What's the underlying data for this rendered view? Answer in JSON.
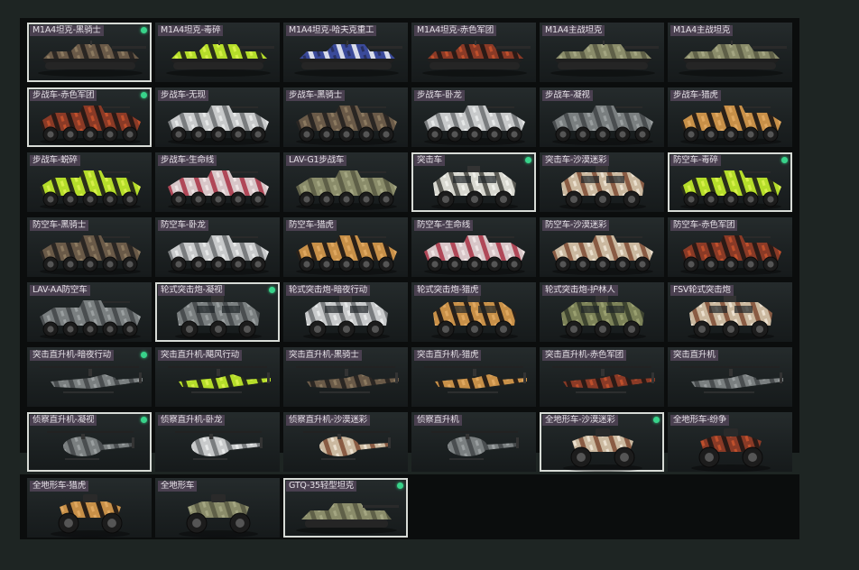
{
  "colors": {
    "bg": "#1e2523",
    "panel": "#0b0d0d",
    "label_bg": "#4a4050",
    "equipped_dot": "#38d38a",
    "selected_border": "#d7dbd6"
  },
  "main": {
    "tiles": [
      {
        "label": "M1A4坦克-黑骑士",
        "kind": "tank",
        "pattern": "blackknight",
        "selected": true,
        "equipped": true
      },
      {
        "label": "M1A4坦克-毒碎",
        "kind": "tank",
        "pattern": "toxic",
        "selected": false,
        "equipped": false
      },
      {
        "label": "M1A4坦克-哈夫克重工",
        "kind": "tank",
        "pattern": "haavk",
        "selected": false,
        "equipped": false
      },
      {
        "label": "M1A4坦克-赤色军团",
        "kind": "tank",
        "pattern": "redlegion",
        "selected": false,
        "equipped": false
      },
      {
        "label": "M1A4主战坦克",
        "kind": "tank",
        "pattern": "olive",
        "selected": false,
        "equipped": false
      },
      {
        "label": "M1A4主战坦克",
        "kind": "tank",
        "pattern": "olive",
        "selected": false,
        "equipped": false
      },
      {
        "label": "步战车-赤色军团",
        "kind": "ifv",
        "pattern": "redlegion",
        "selected": true,
        "equipped": true
      },
      {
        "label": "步战车-无现",
        "kind": "ifv",
        "pattern": "white",
        "selected": false,
        "equipped": false
      },
      {
        "label": "步战车-黑骑士",
        "kind": "ifv",
        "pattern": "blackknight",
        "selected": false,
        "equipped": false
      },
      {
        "label": "步战车-卧龙",
        "kind": "ifv",
        "pattern": "white",
        "selected": false,
        "equipped": false
      },
      {
        "label": "步战车-凝视",
        "kind": "ifv",
        "pattern": "grey",
        "selected": false,
        "equipped": false
      },
      {
        "label": "步战车-猎虎",
        "kind": "ifv",
        "pattern": "tiger",
        "selected": false,
        "equipped": false
      },
      {
        "label": "步战车-蜕碎",
        "kind": "ifv",
        "pattern": "toxic",
        "selected": false,
        "equipped": false
      },
      {
        "label": "步战车-生命线",
        "kind": "ifv",
        "pattern": "pinkwhite",
        "selected": false,
        "equipped": false
      },
      {
        "label": "LAV-G1步战车",
        "kind": "ifv",
        "pattern": "olive",
        "selected": false,
        "equipped": false
      },
      {
        "label": "突击车",
        "kind": "mrap",
        "pattern": "snowcamo",
        "selected": true,
        "equipped": true
      },
      {
        "label": "突击车-沙漠迷彩",
        "kind": "mrap",
        "pattern": "desertcamo",
        "selected": false,
        "equipped": false
      },
      {
        "label": "防空车-毒碎",
        "kind": "ifv",
        "pattern": "toxic",
        "selected": true,
        "equipped": true
      },
      {
        "label": "防空车-黑骑士",
        "kind": "ifv",
        "pattern": "blackknight",
        "selected": false,
        "equipped": false
      },
      {
        "label": "防空车-卧龙",
        "kind": "ifv",
        "pattern": "white",
        "selected": false,
        "equipped": false
      },
      {
        "label": "防空车-猎虎",
        "kind": "ifv",
        "pattern": "tiger",
        "selected": false,
        "equipped": false
      },
      {
        "label": "防空车-生命线",
        "kind": "ifv",
        "pattern": "pinkwhite",
        "selected": false,
        "equipped": false
      },
      {
        "label": "防空车-沙漠迷彩",
        "kind": "ifv",
        "pattern": "desertcamo",
        "selected": false,
        "equipped": false
      },
      {
        "label": "防空车-赤色军团",
        "kind": "ifv",
        "pattern": "redlegion",
        "selected": false,
        "equipped": false
      },
      {
        "label": "LAV-AA防空车",
        "kind": "ifv",
        "pattern": "grey",
        "selected": false,
        "equipped": false
      },
      {
        "label": "轮式突击炮-凝视",
        "kind": "armored",
        "pattern": "grey",
        "selected": true,
        "equipped": true
      },
      {
        "label": "轮式突击炮-暗夜行动",
        "kind": "armored",
        "pattern": "white",
        "selected": false,
        "equipped": false
      },
      {
        "label": "轮式突击炮-猎虎",
        "kind": "armored",
        "pattern": "tiger",
        "selected": false,
        "equipped": false
      },
      {
        "label": "轮式突击炮-护林人",
        "kind": "armored",
        "pattern": "forest",
        "selected": false,
        "equipped": false
      },
      {
        "label": "FSV轮式突击炮",
        "kind": "armored",
        "pattern": "desertcamo",
        "selected": false,
        "equipped": false
      },
      {
        "label": "突击直升机-暗夜行动",
        "kind": "heli",
        "pattern": "grey",
        "selected": false,
        "equipped": true
      },
      {
        "label": "突击直升机-飓风行动",
        "kind": "heli",
        "pattern": "toxic",
        "selected": false,
        "equipped": false
      },
      {
        "label": "突击直升机-黑骑士",
        "kind": "heli",
        "pattern": "blackknight",
        "selected": false,
        "equipped": false
      },
      {
        "label": "突击直升机-猎虎",
        "kind": "heli",
        "pattern": "tiger",
        "selected": false,
        "equipped": false
      },
      {
        "label": "突击直升机-赤色军团",
        "kind": "heli",
        "pattern": "redlegion",
        "selected": false,
        "equipped": false
      },
      {
        "label": "突击直升机",
        "kind": "heli",
        "pattern": "grey",
        "selected": false,
        "equipped": false
      },
      {
        "label": "侦察直升机-凝视",
        "kind": "scout",
        "pattern": "grey",
        "selected": true,
        "equipped": true
      },
      {
        "label": "侦察直升机-卧龙",
        "kind": "scout",
        "pattern": "white",
        "selected": false,
        "equipped": false
      },
      {
        "label": "侦察直升机-沙漠迷彩",
        "kind": "scout",
        "pattern": "desertcamo",
        "selected": false,
        "equipped": false
      },
      {
        "label": "侦察直升机",
        "kind": "scout",
        "pattern": "grey",
        "selected": false,
        "equipped": false
      },
      {
        "label": "全地形车-沙漠迷彩",
        "kind": "atv",
        "pattern": "desertcamo",
        "selected": true,
        "equipped": true
      },
      {
        "label": "全地形车-纷争",
        "kind": "atv",
        "pattern": "redlegion",
        "selected": false,
        "equipped": false
      }
    ]
  },
  "extra": {
    "tiles": [
      {
        "label": "全地形车-猎虎",
        "kind": "atv",
        "pattern": "tiger",
        "selected": false,
        "equipped": false
      },
      {
        "label": "全地形车",
        "kind": "atv",
        "pattern": "olive",
        "selected": false,
        "equipped": false
      },
      {
        "label": "GTQ-35轻型坦克",
        "kind": "lighttank",
        "pattern": "olive",
        "selected": true,
        "equipped": true
      }
    ]
  }
}
